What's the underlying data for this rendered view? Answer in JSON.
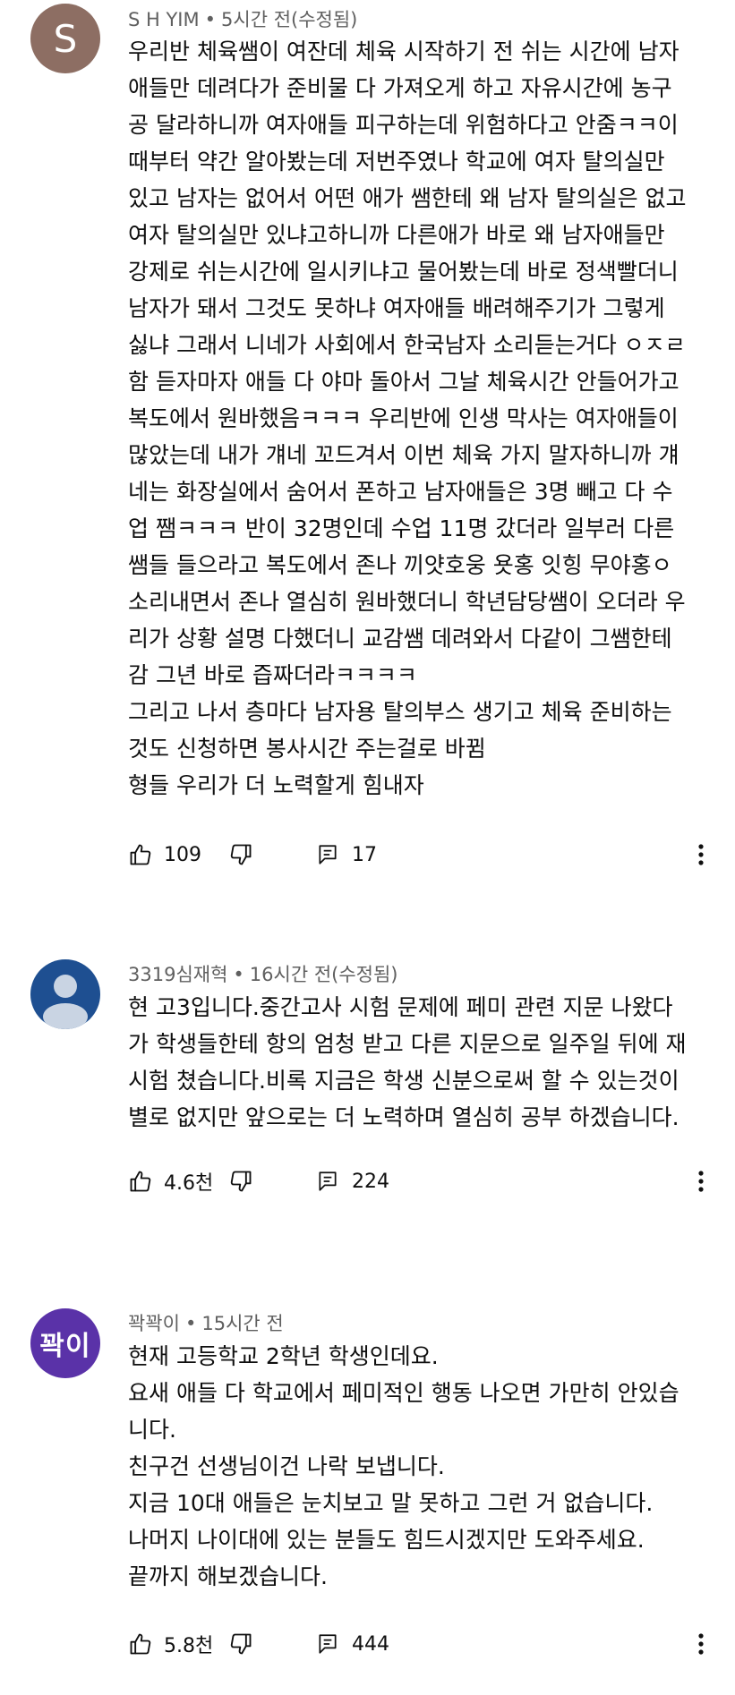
{
  "comments": [
    {
      "avatar_letter": "S",
      "avatar_color": "#8d6e63",
      "author": "S H YIM",
      "time": "5시간 전(수정됨)",
      "lines": [
        "우리반 체육쌤이 여잔데 체육 시작하기 전 쉬는 시간에 남자",
        "애들만 데려다가  준비물 다 가져오게 하고 자유시간에 농구",
        "공 달라하니까 여자애들 피구하는데 위험하다고 안줌ㅋㅋ이",
        "때부터 약간 알아봤는데 저번주였나 학교에 여자 탈의실만",
        "있고 남자는 없어서 어떤 애가 쌤한테 왜 남자 탈의실은 없고",
        "여자 탈의실만 있냐고하니까 다른애가 바로 왜 남자애들만",
        "강제로 쉬는시간에 일시키냐고 물어봤는데 바로 정색빨더니",
        "남자가 돼서 그것도 못하냐 여자애들 배려해주기가 그렇게",
        "싫냐 그래서 니네가 사회에서 한국남자 소리듣는거다 ㅇㅈㄹ",
        "함 듣자마자 애들 다 야마 돌아서 그날 체육시간 안들어가고",
        "복도에서 원바했음ㅋㅋㅋ 우리반에 인생 막사는 여자애들이",
        "많았는데 내가 걔네 꼬드겨서 이번 체육 가지 말자하니까 걔",
        "네는 화장실에서 숨어서 폰하고 남자애들은 3명 빼고 다 수",
        "업 쨈ㅋㅋㅋ 반이 32명인데 수업 11명 갔더라 일부러 다른",
        "쌤들 들으라고 복도에서 존나 끼얏호웅 욧홍 잇힝 무야홍ㅇ",
        "소리내면서 존나 열심히 원바했더니 학년담당쌤이 오더라 우",
        "리가 상황 설명 다했더니 교감쌤 데려와서 다같이 그쌤한테",
        "감 그년 바로 즙짜더라ㅋㅋㅋㅋ",
        "그리고 나서 층마다 남자용 탈의부스 생기고 체육 준비하는",
        "것도 신청하면 봉사시간 주는걸로 바뀜",
        "형들 우리가 더 노력할게 힘내자"
      ],
      "likes": "109",
      "replies": "17"
    },
    {
      "avatar_color": "#1e4f91",
      "author": "3319심재혁",
      "time": "16시간 전(수정됨)",
      "lines": [
        "현 고3입니다.중간고사 시험 문제에 페미 관련 지문 나왔다",
        "가 학생들한테 항의 엄청 받고 다른 지문으로 일주일 뒤에 재",
        "시험 쳤습니다.비록 지금은 학생 신분으로써 할 수 있는것이",
        "별로 없지만 앞으로는 더 노력하며 열심히 공부 하겠습니다."
      ],
      "likes": "4.6천",
      "replies": "224"
    },
    {
      "avatar_text": "꽉이",
      "avatar_color": "#5a32a8",
      "author": "꽉꽉이",
      "time": "15시간 전",
      "lines": [
        "현재 고등학교 2학년 학생인데요.",
        "요새 애들 다 학교에서 페미적인 행동 나오면 가만히 안있습",
        "니다.",
        "친구건 선생님이건 나락 보냅니다.",
        "지금 10대 애들은 눈치보고 말 못하고 그런 거 없습니다.",
        "나머지 나이대에 있는 분들도 힘드시겠지만 도와주세요.",
        "끝까지 해보겠습니다."
      ],
      "likes": "5.8천",
      "replies": "444"
    }
  ],
  "icons": {
    "like": "thumbs-up-icon",
    "dislike": "thumbs-down-icon",
    "reply": "reply-comment-icon",
    "more": "more-vertical-icon"
  },
  "meta_separator": "•"
}
